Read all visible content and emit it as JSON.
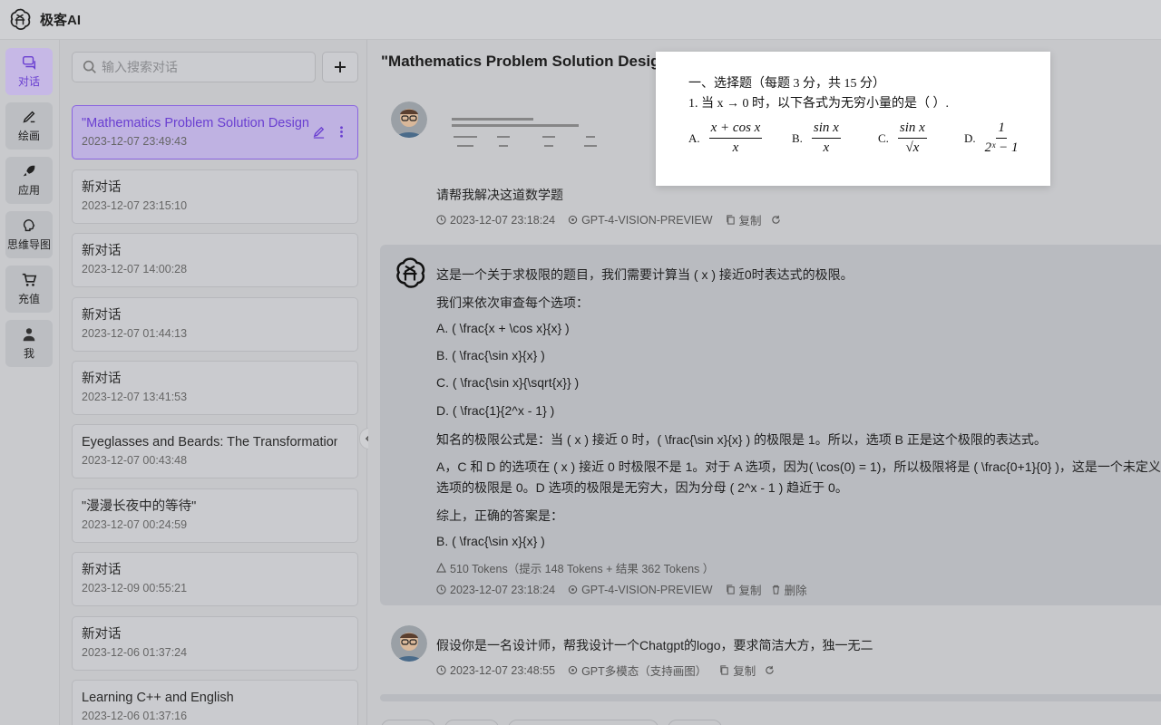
{
  "app": {
    "name": "极客AI"
  },
  "rail": {
    "items": [
      {
        "label": "对话",
        "icon": "chat-icon"
      },
      {
        "label": "绘画",
        "icon": "brush-icon"
      },
      {
        "label": "应用",
        "icon": "rocket-icon"
      },
      {
        "label": "思维导图",
        "icon": "brain-icon"
      },
      {
        "label": "充值",
        "icon": "cart-icon"
      },
      {
        "label": "我",
        "icon": "user-icon"
      }
    ]
  },
  "conv": {
    "search_placeholder": "输入搜索对话",
    "items": [
      {
        "title": "\"Mathematics Problem Solution Design\"",
        "date": "2023-12-07 23:49:43"
      },
      {
        "title": "新对话",
        "date": "2023-12-07 23:15:10"
      },
      {
        "title": "新对话",
        "date": "2023-12-07 14:00:28"
      },
      {
        "title": "新对话",
        "date": "2023-12-07 01:44:13"
      },
      {
        "title": "新对话",
        "date": "2023-12-07 13:41:53"
      },
      {
        "title": "Eyeglasses and Beards: The Transformation",
        "date": "2023-12-07 00:43:48"
      },
      {
        "title": "\"漫漫长夜中的等待\"",
        "date": "2023-12-07 00:24:59"
      },
      {
        "title": "新对话",
        "date": "2023-12-09 00:55:21"
      },
      {
        "title": "新对话",
        "date": "2023-12-06 01:37:24"
      },
      {
        "title": "Learning C++ and English",
        "date": "2023-12-06 01:37:16"
      }
    ]
  },
  "chat": {
    "title": "\"Mathematics Problem Solution Design\"",
    "user_msg1": {
      "text": "请帮我解决这道数学题",
      "time": "2023-12-07 23:18:24",
      "model": "GPT-4-VISION-PREVIEW",
      "copy": "复制"
    },
    "ai_msg": {
      "lines": [
        "这是一个关于求极限的题目，我们需要计算当 ( x ) 接近0时表达式的极限。",
        "我们来依次审查每个选项：",
        "A. ( \\frac{x + \\cos x}{x} )",
        "B. ( \\frac{\\sin x}{x} )",
        "C. ( \\frac{\\sin x}{\\sqrt{x}} )",
        "D. ( \\frac{1}{2^x - 1} )",
        "知名的极限公式是：当 ( x ) 接近 0 时，( \\frac{\\sin x}{x} ) 的极限是 1。所以，选项 B 正是这个极限的表达式。",
        "A，C 和 D 的选项在 ( x ) 接近 0 时极限不是 1。对于 A 选项，因为( \\cos(0) = 1)，所以极限将是 ( \\frac{0+1}{0} )，这是一个未定义",
        "选项的极限是 0。D 选项的极限是无穷大，因为分母 ( 2^x - 1 ) 趋近于 0。",
        "综上，正确的答案是：",
        "B. ( \\frac{\\sin x}{x} )"
      ],
      "tokens": "510 Tokens（提示 148 Tokens + 结果 362 Tokens ）",
      "time": "2023-12-07 23:18:24",
      "model": "GPT-4-VISION-PREVIEW",
      "copy": "复制",
      "delete": "删除"
    },
    "user_msg2": {
      "text": "假设你是一名设计师，帮我设计一个Chatgpt的logo，要求简洁大方，独一无二",
      "time": "2023-12-07 23:48:55",
      "model": "GPT多模态（支持画图）",
      "copy": "复制"
    }
  },
  "preview": {
    "heading": "一、选择题（每题 3 分，共 15 分）",
    "question": "1.  当 x → 0 时，以下各式为无穷小量的是（    ）.",
    "options": [
      {
        "label": "A.",
        "num": "x + cos x",
        "den": "x"
      },
      {
        "label": "B.",
        "num": "sin x",
        "den": "x"
      },
      {
        "label": "C.",
        "num": "sin x",
        "den": "√x"
      },
      {
        "label": "D.",
        "num": "1",
        "den": "2ˣ − 1"
      }
    ]
  },
  "colors": {
    "accent": "#6a3fd1",
    "active_bg": "#bfb2e2"
  }
}
